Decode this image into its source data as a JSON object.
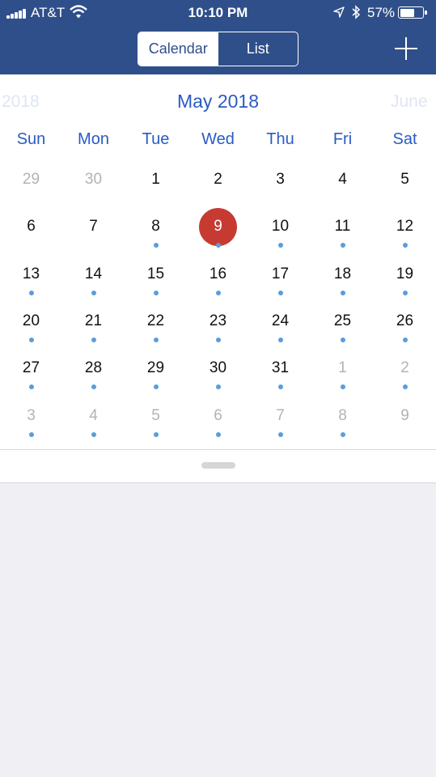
{
  "status_bar": {
    "carrier": "AT&T",
    "time": "10:10 PM",
    "battery_pct": "57%",
    "battery_level": 0.57,
    "icons": [
      "signal-icon",
      "wifi-icon",
      "location-arrow-icon",
      "bluetooth-icon",
      "battery-icon"
    ]
  },
  "header": {
    "tabs": [
      {
        "label": "Calendar",
        "selected": true
      },
      {
        "label": "List",
        "selected": false
      }
    ],
    "add_icon": "plus-icon"
  },
  "calendar": {
    "prev_month": "2018",
    "current_month": "May 2018",
    "next_month": "June",
    "weekdays": [
      "Sun",
      "Mon",
      "Tue",
      "Wed",
      "Thu",
      "Fri",
      "Sat"
    ],
    "weeks": [
      [
        {
          "day": "29",
          "other": true,
          "dot": false
        },
        {
          "day": "30",
          "other": true,
          "dot": false
        },
        {
          "day": "1",
          "other": false,
          "dot": false
        },
        {
          "day": "2",
          "other": false,
          "dot": false
        },
        {
          "day": "3",
          "other": false,
          "dot": false
        },
        {
          "day": "4",
          "other": false,
          "dot": false
        },
        {
          "day": "5",
          "other": false,
          "dot": false
        }
      ],
      [
        {
          "day": "6",
          "other": false,
          "dot": false
        },
        {
          "day": "7",
          "other": false,
          "dot": false
        },
        {
          "day": "8",
          "other": false,
          "dot": true
        },
        {
          "day": "9",
          "other": false,
          "dot": true,
          "selected": true
        },
        {
          "day": "10",
          "other": false,
          "dot": true
        },
        {
          "day": "11",
          "other": false,
          "dot": true
        },
        {
          "day": "12",
          "other": false,
          "dot": true
        }
      ],
      [
        {
          "day": "13",
          "other": false,
          "dot": true
        },
        {
          "day": "14",
          "other": false,
          "dot": true
        },
        {
          "day": "15",
          "other": false,
          "dot": true
        },
        {
          "day": "16",
          "other": false,
          "dot": true
        },
        {
          "day": "17",
          "other": false,
          "dot": true
        },
        {
          "day": "18",
          "other": false,
          "dot": true
        },
        {
          "day": "19",
          "other": false,
          "dot": true
        }
      ],
      [
        {
          "day": "20",
          "other": false,
          "dot": true
        },
        {
          "day": "21",
          "other": false,
          "dot": true
        },
        {
          "day": "22",
          "other": false,
          "dot": true
        },
        {
          "day": "23",
          "other": false,
          "dot": true
        },
        {
          "day": "24",
          "other": false,
          "dot": true
        },
        {
          "day": "25",
          "other": false,
          "dot": true
        },
        {
          "day": "26",
          "other": false,
          "dot": true
        }
      ],
      [
        {
          "day": "27",
          "other": false,
          "dot": true
        },
        {
          "day": "28",
          "other": false,
          "dot": true
        },
        {
          "day": "29",
          "other": false,
          "dot": true
        },
        {
          "day": "30",
          "other": false,
          "dot": true
        },
        {
          "day": "31",
          "other": false,
          "dot": true
        },
        {
          "day": "1",
          "other": true,
          "dot": true
        },
        {
          "day": "2",
          "other": true,
          "dot": true
        }
      ],
      [
        {
          "day": "3",
          "other": true,
          "dot": true
        },
        {
          "day": "4",
          "other": true,
          "dot": true
        },
        {
          "day": "5",
          "other": true,
          "dot": true
        },
        {
          "day": "6",
          "other": true,
          "dot": true
        },
        {
          "day": "7",
          "other": true,
          "dot": true
        },
        {
          "day": "8",
          "other": true,
          "dot": true
        },
        {
          "day": "9",
          "other": true,
          "dot": false
        }
      ]
    ]
  },
  "colors": {
    "header_bg": "#2f4f8a",
    "accent_blue": "#2a5bc4",
    "event_dot": "#5a9ddc",
    "selected_day": "#c73a32",
    "background": "#efeff4"
  }
}
